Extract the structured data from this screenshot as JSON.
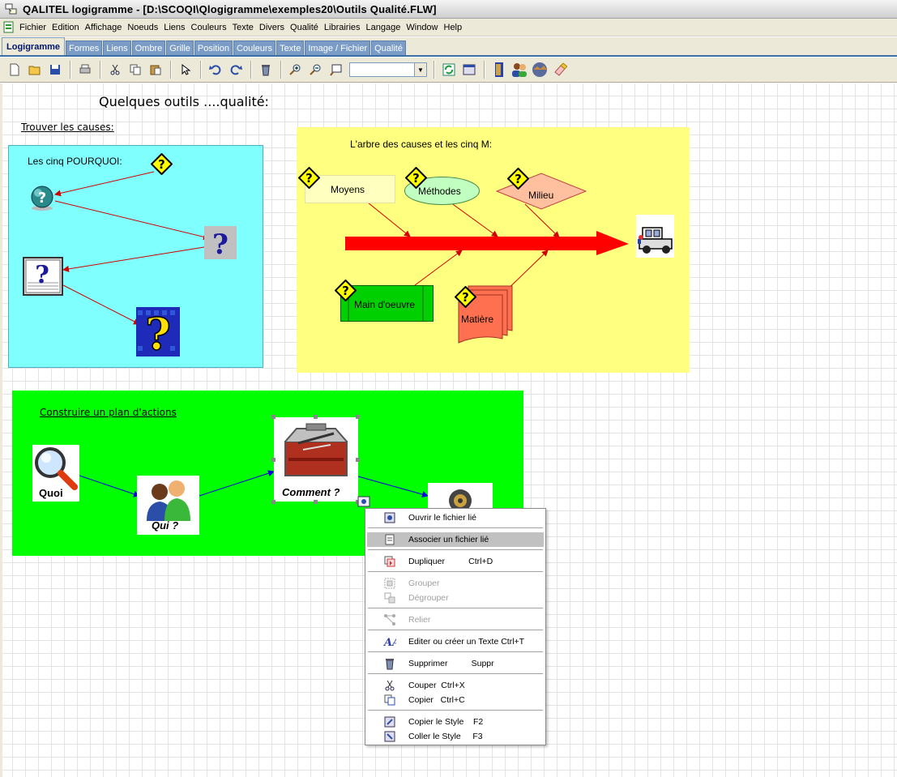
{
  "window": {
    "title": "QALITEL logigramme - [D:\\SCOQI\\Qlogigramme\\exemples20\\Outils Qualité.FLW]"
  },
  "menu": [
    "Fichier",
    "Edition",
    "Affichage",
    "Noeuds",
    "Liens",
    "Couleurs",
    "Texte",
    "Divers",
    "Qualité",
    "Librairies",
    "Langage",
    "Window",
    "Help"
  ],
  "tabs": [
    "Logigramme",
    "Formes",
    "Liens",
    "Ombre",
    "Grille",
    "Position",
    "Couleurs",
    "Texte",
    "Image / Fichier",
    "Qualité"
  ],
  "toolbar": {
    "icons": [
      "new-icon",
      "open-icon",
      "save-icon",
      "print-icon",
      "cut-icon",
      "copy-icon",
      "paste-icon",
      "pointer-icon",
      "undo-icon",
      "redo-icon",
      "delete-icon",
      "zoom-in-icon",
      "zoom-out-icon",
      "zoom-fit-icon",
      "refresh-icon",
      "window-icon",
      "door-icon",
      "users-icon",
      "globe-icon",
      "eraser-icon"
    ],
    "zoom_value": ""
  },
  "diagram": {
    "title": "Quelques outils ....qualité:",
    "section_causes": "Trouver les causes:",
    "pourquoi_label": "Les cinq POURQUOI:",
    "arbre_label": "L'arbre des causes et les cinq M:",
    "nodes": {
      "moyens": "Moyens",
      "methodes": "Méthodes",
      "milieu": "Milieu",
      "main_oeuvre": "Main d'oeuvre",
      "matiere": "Matière"
    },
    "plan_label": "Construire un plan d'actions",
    "quoi": "Quoi",
    "qui": "Qui ?",
    "comment": "Comment ?"
  },
  "context_menu": {
    "items": [
      {
        "label": "Ouvrir le fichier lié",
        "icon": "eye-icon",
        "disabled": false
      },
      {
        "label": "Associer un fichier lié",
        "icon": "link-file-icon",
        "disabled": false,
        "highlighted": true
      },
      {
        "label": "Dupliquer          Ctrl+D",
        "icon": "duplicate-icon",
        "disabled": false
      },
      {
        "label": "Grouper",
        "icon": "group-icon",
        "disabled": true
      },
      {
        "label": "Dégrouper",
        "icon": "ungroup-icon",
        "disabled": true
      },
      {
        "label": "Relier",
        "icon": "connect-icon",
        "disabled": true
      },
      {
        "label": "Editer ou créer un Texte Ctrl+T",
        "icon": "text-icon",
        "disabled": false
      },
      {
        "label": "Supprimer          Suppr",
        "icon": "trash-icon",
        "disabled": false
      },
      {
        "label": "Couper  Ctrl+X",
        "icon": "scissors-icon",
        "disabled": false
      },
      {
        "label": "Copier   Ctrl+C",
        "icon": "copy-icon",
        "disabled": false
      },
      {
        "label": "Copier le Style    F2",
        "icon": "copy-style-icon",
        "disabled": false
      },
      {
        "label": "Coller le Style     F3",
        "icon": "paste-style-icon",
        "disabled": false
      }
    ]
  }
}
